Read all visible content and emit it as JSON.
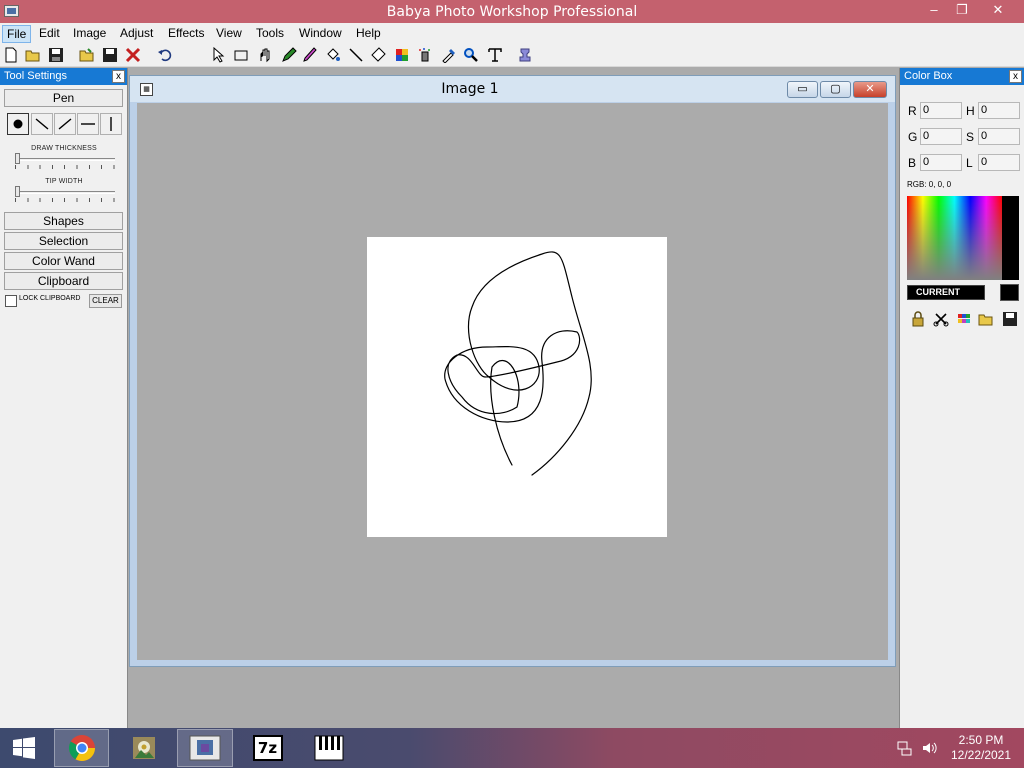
{
  "app": {
    "title": "Babya Photo Workshop Professional",
    "window_controls": {
      "minimize": "–",
      "restore": "❐",
      "close": "✕"
    }
  },
  "menu": [
    "File",
    "Edit",
    "Image",
    "Adjust",
    "Effects",
    "View",
    "Tools",
    "Window",
    "Help"
  ],
  "toolbar_icons": [
    "new-file-icon",
    "open-folder-icon",
    "save-icon",
    "open-icon",
    "save-as-icon",
    "close-file-icon",
    "undo-icon",
    "pointer-icon",
    "rectangle-select-icon",
    "hand-icon",
    "pen-icon",
    "brush-icon",
    "fill-bucket-icon",
    "line-icon",
    "eraser-icon",
    "color-picker-icon",
    "spray-icon",
    "eyedropper-icon",
    "magnifier-icon",
    "text-icon",
    "stamp-icon"
  ],
  "tool_settings": {
    "title": "Tool Settings",
    "close": "x",
    "current_tool": "Pen",
    "draw_thickness_label": "DRAW THICKNESS",
    "draw_thickness_level": 0,
    "tip_width_label": "TIP WIDTH",
    "tip_width_level": 0,
    "sections": [
      "Shapes",
      "Selection",
      "Color Wand",
      "Clipboard"
    ],
    "lock_clipboard_label": "LOCK CLIPBOARD",
    "clear_label": "CLEAR"
  },
  "document": {
    "title": "Image  1",
    "icon_glyph": "▦",
    "controls": {
      "minimize": "▭",
      "maximize": "▢",
      "close": "✕"
    }
  },
  "color_box": {
    "title": "Color Box",
    "close": "x",
    "fields": [
      {
        "label": "R",
        "value": "0"
      },
      {
        "label": "H",
        "value": "0"
      },
      {
        "label": "G",
        "value": "0"
      },
      {
        "label": "S",
        "value": "0"
      },
      {
        "label": "B",
        "value": "0"
      },
      {
        "label": "L",
        "value": "0"
      }
    ],
    "rgb_readout": "RGB: 0, 0, 0",
    "current_label": "CURRENT",
    "current_color": "#000000",
    "icons": [
      "lock-icon",
      "cut-icon",
      "palette-icon",
      "open-folder-icon",
      "save-icon"
    ]
  },
  "taskbar": {
    "apps": [
      "start-icon",
      "chrome-icon",
      "photo-app-icon",
      "babya-icon",
      "7zip-icon",
      "piano-icon"
    ],
    "sevenzip_label": "7z",
    "time": "2:50 PM",
    "date": "12/22/2021"
  },
  "colors": {
    "titlebar": "#c4616e",
    "panel_header": "#1779d4",
    "workspace": "#ababab"
  }
}
